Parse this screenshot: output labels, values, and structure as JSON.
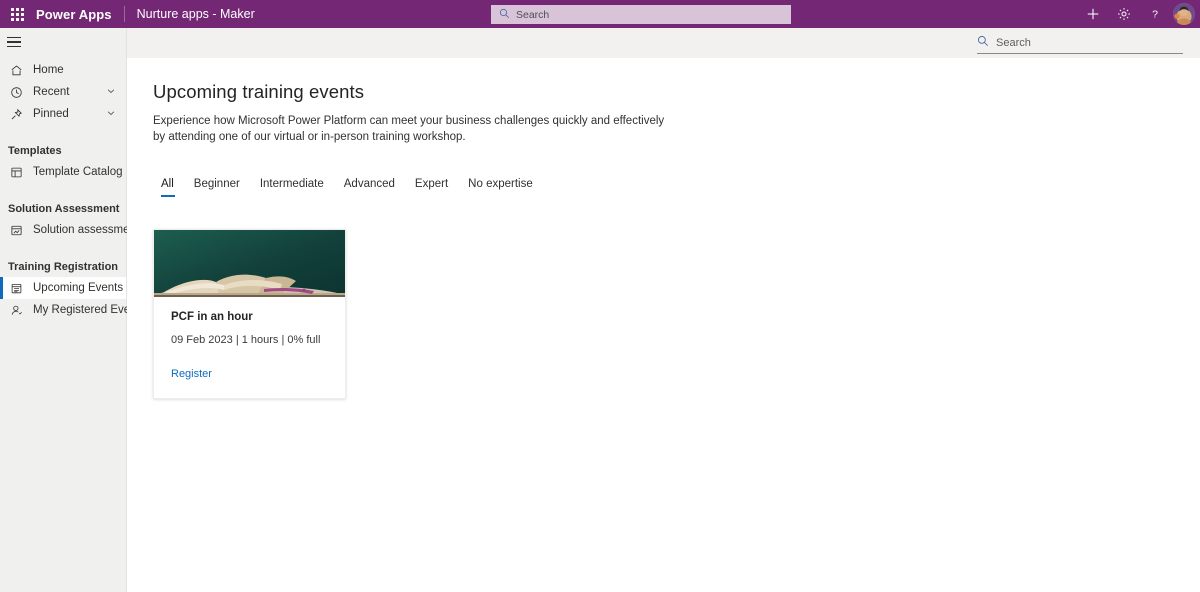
{
  "header": {
    "waffle_icon": "app-launcher-icon",
    "brand": "Power Apps",
    "app_name": "Nurture apps - Maker",
    "search": {
      "placeholder": "Search",
      "value": "",
      "icon": "search-icon"
    },
    "actions": [
      {
        "name": "new-button",
        "icon": "plus-icon",
        "glyph": "+"
      },
      {
        "name": "settings-button",
        "icon": "gear-icon",
        "glyph": "⚙"
      },
      {
        "name": "help-button",
        "icon": "question-icon",
        "glyph": "?"
      }
    ],
    "avatar_label": "User avatar",
    "brand_color": "#742774"
  },
  "command_bar": {
    "search": {
      "placeholder": "Search",
      "value": "",
      "icon": "search-icon"
    }
  },
  "sidebar": {
    "hamburger_icon": "hamburger-menu-icon",
    "items": [
      {
        "label": "Home",
        "icon": "home-icon",
        "selected": false,
        "expandable": false
      },
      {
        "label": "Recent",
        "icon": "clock-icon",
        "selected": false,
        "expandable": true
      },
      {
        "label": "Pinned",
        "icon": "pin-icon",
        "selected": false,
        "expandable": true
      }
    ],
    "groups": [
      {
        "title": "Templates",
        "items": [
          {
            "label": "Template Catalog",
            "icon": "catalog-icon",
            "selected": false
          }
        ]
      },
      {
        "title": "Solution Assessment",
        "items": [
          {
            "label": "Solution assessment",
            "icon": "assessment-icon",
            "selected": false
          }
        ]
      },
      {
        "title": "Training Registration",
        "items": [
          {
            "label": "Upcoming Events",
            "icon": "calendar-events-icon",
            "selected": true
          },
          {
            "label": "My Registered Events",
            "icon": "person-icon",
            "selected": false
          }
        ]
      }
    ],
    "accent_color": "#0f6cbd"
  },
  "main": {
    "title": "Upcoming training events",
    "description": "Experience how Microsoft Power Platform can meet your business challenges quickly and effectively by attending one of our virtual or in-person training workshop.",
    "tabs": [
      {
        "label": "All",
        "active": true
      },
      {
        "label": "Beginner",
        "active": false
      },
      {
        "label": "Intermediate",
        "active": false
      },
      {
        "label": "Advanced",
        "active": false
      },
      {
        "label": "Expert",
        "active": false
      },
      {
        "label": "No expertise",
        "active": false
      }
    ],
    "cards": [
      {
        "title": "PCF in an hour",
        "meta": "09 Feb 2023 | 1 hours | 0% full",
        "link_label": "Register",
        "image_alt": "open-book-on-teal-background",
        "image_color": "#12403a"
      }
    ]
  }
}
